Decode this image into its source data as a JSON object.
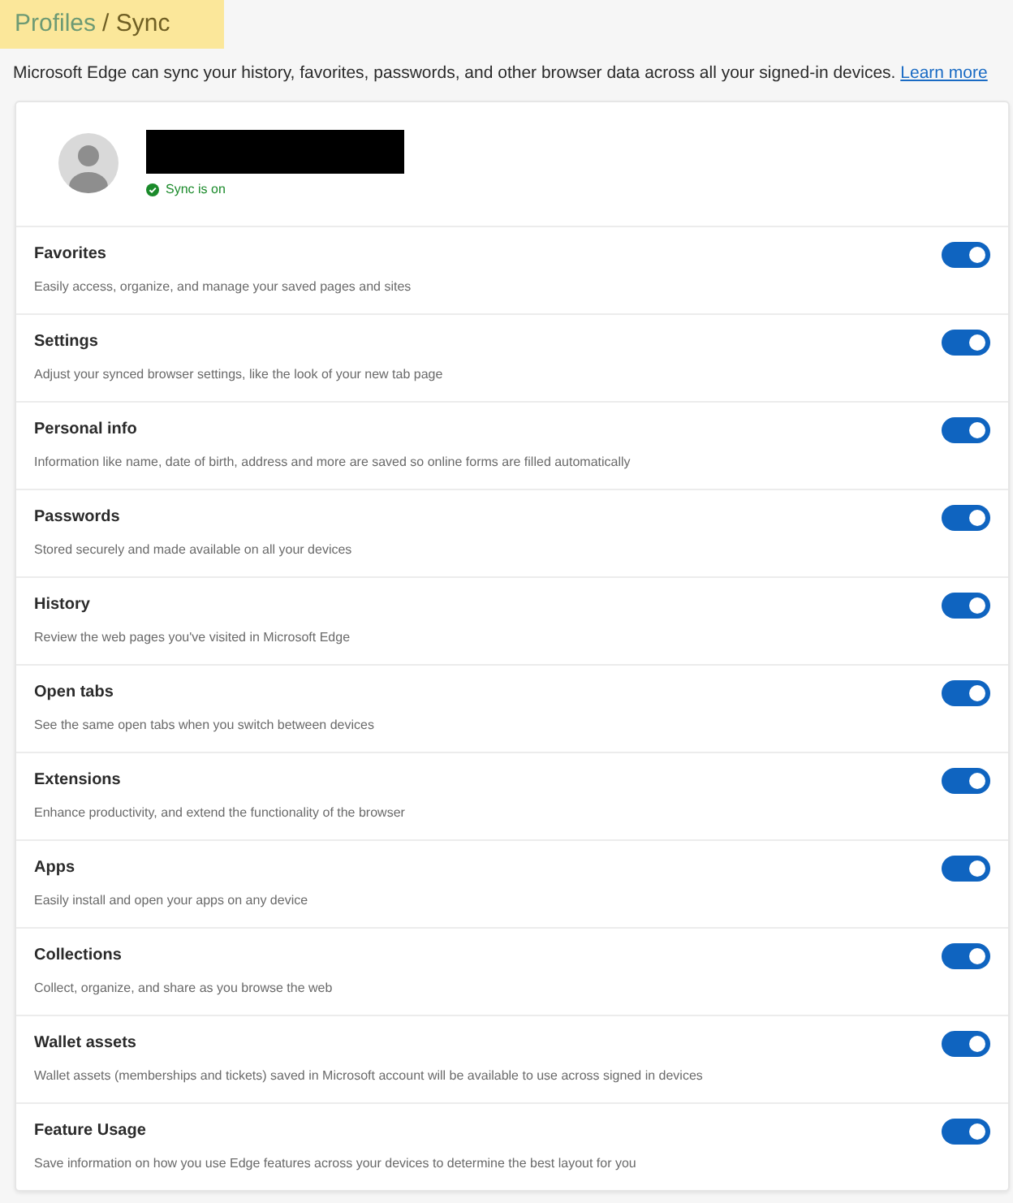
{
  "breadcrumb": {
    "parent": "Profiles",
    "current": "/ Sync",
    "highlighted": true
  },
  "intro": {
    "text": "Microsoft Edge can sync your history, favorites, passwords, and other browser data across all your signed-in devices.",
    "link": "Learn more"
  },
  "profile": {
    "name_redacted": true,
    "status": "Sync is on",
    "sync_on": true
  },
  "sync_items": [
    {
      "title": "Favorites",
      "description": "Easily access, organize, and manage your saved pages and sites",
      "on": true
    },
    {
      "title": "Settings",
      "description": "Adjust your synced browser settings, like the look of your new tab page",
      "on": true
    },
    {
      "title": "Personal info",
      "description": "Information like name, date of birth, address and more are saved so online forms are filled automatically",
      "on": true
    },
    {
      "title": "Passwords",
      "description": "Stored securely and made available on all your devices",
      "on": true
    },
    {
      "title": "History",
      "description": "Review the web pages you've visited in Microsoft Edge",
      "on": true
    },
    {
      "title": "Open tabs",
      "description": "See the same open tabs when you switch between devices",
      "on": true
    },
    {
      "title": "Extensions",
      "description": "Enhance productivity, and extend the functionality of the browser",
      "on": true
    },
    {
      "title": "Apps",
      "description": "Easily install and open your apps on any device",
      "on": true
    },
    {
      "title": "Collections",
      "description": "Collect, organize, and share as you browse the web",
      "on": true
    },
    {
      "title": "Wallet assets",
      "description": "Wallet assets (memberships and tickets) saved in Microsoft account will be available to use across signed in devices",
      "on": true
    },
    {
      "title": "Feature Usage",
      "description": "Save information on how you use Edge features across your devices to determine the best layout for you",
      "on": true
    }
  ]
}
